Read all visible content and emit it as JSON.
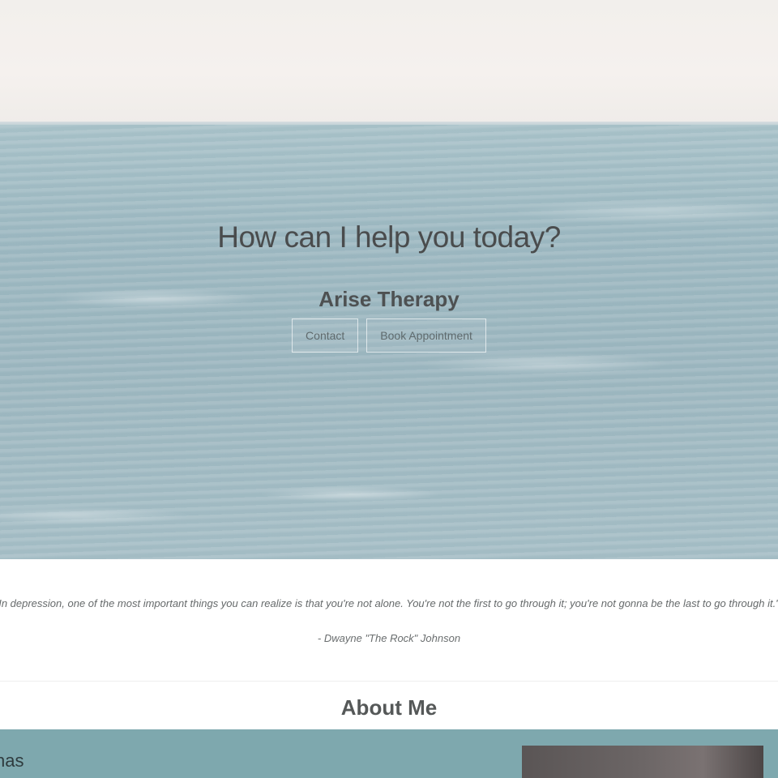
{
  "hero": {
    "title": "How can I help you today?",
    "subtitle": "Arise Therapy",
    "buttons": [
      {
        "label": "Contact"
      },
      {
        "label": "Book Appointment"
      }
    ]
  },
  "quote": {
    "text": "In depression, one of the most important things you can realize is that you're not alone. You're not the first to go through it; you're not gonna be the last to go through it.\"",
    "author": "- Dwayne \"The Rock\" Johnson"
  },
  "about": {
    "heading": "About Me",
    "name_fragment": "nas"
  },
  "colors": {
    "accent_band": "#7ea8ae",
    "sea": "#9cb6bf",
    "text_dark": "#4a4c4d"
  }
}
